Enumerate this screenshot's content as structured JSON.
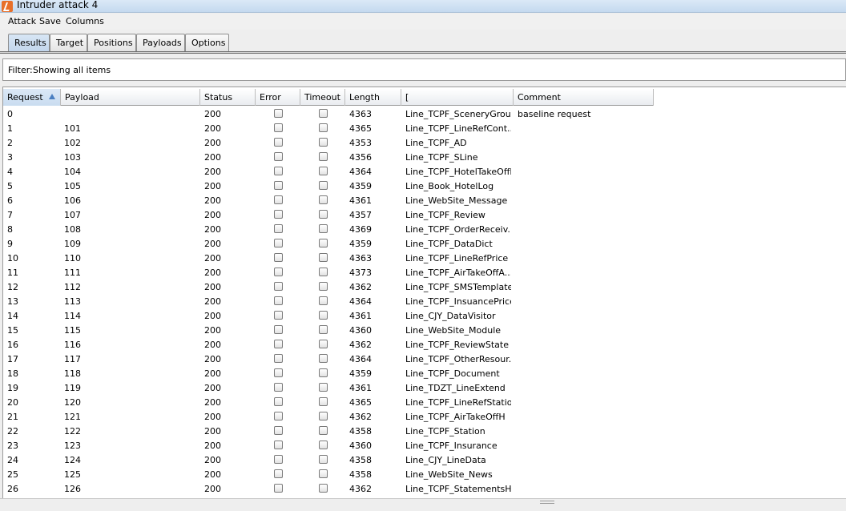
{
  "window": {
    "title": "Intruder attack 4"
  },
  "menu": [
    "Attack",
    "Save",
    "Columns"
  ],
  "tabs": [
    "Results",
    "Target",
    "Positions",
    "Payloads",
    "Options"
  ],
  "active_tab": "Results",
  "filter": {
    "label": "Filter:",
    "value": "Showing all items"
  },
  "columns": [
    "Request",
    "Payload",
    "Status",
    "Error",
    "Timeout",
    "Length",
    "[",
    "Comment"
  ],
  "rows": [
    {
      "request": "0",
      "payload": "",
      "status": "200",
      "error": false,
      "timeout": false,
      "length": "4363",
      "match": "Line_TCPF_SceneryGroup",
      "comment": "baseline request"
    },
    {
      "request": "1",
      "payload": "101",
      "status": "200",
      "error": false,
      "timeout": false,
      "length": "4365",
      "match": "Line_TCPF_LineRefCont...",
      "comment": ""
    },
    {
      "request": "2",
      "payload": "102",
      "status": "200",
      "error": false,
      "timeout": false,
      "length": "4353",
      "match": "Line_TCPF_AD",
      "comment": ""
    },
    {
      "request": "3",
      "payload": "103",
      "status": "200",
      "error": false,
      "timeout": false,
      "length": "4356",
      "match": "Line_TCPF_SLine",
      "comment": ""
    },
    {
      "request": "4",
      "payload": "104",
      "status": "200",
      "error": false,
      "timeout": false,
      "length": "4364",
      "match": "Line_TCPF_HotelTakeOffL",
      "comment": ""
    },
    {
      "request": "5",
      "payload": "105",
      "status": "200",
      "error": false,
      "timeout": false,
      "length": "4359",
      "match": "Line_Book_HotelLog",
      "comment": ""
    },
    {
      "request": "6",
      "payload": "106",
      "status": "200",
      "error": false,
      "timeout": false,
      "length": "4361",
      "match": "Line_WebSite_Message",
      "comment": ""
    },
    {
      "request": "7",
      "payload": "107",
      "status": "200",
      "error": false,
      "timeout": false,
      "length": "4357",
      "match": "Line_TCPF_Review",
      "comment": ""
    },
    {
      "request": "8",
      "payload": "108",
      "status": "200",
      "error": false,
      "timeout": false,
      "length": "4369",
      "match": "Line_TCPF_OrderReceiv...",
      "comment": ""
    },
    {
      "request": "9",
      "payload": "109",
      "status": "200",
      "error": false,
      "timeout": false,
      "length": "4359",
      "match": "Line_TCPF_DataDict",
      "comment": ""
    },
    {
      "request": "10",
      "payload": "110",
      "status": "200",
      "error": false,
      "timeout": false,
      "length": "4363",
      "match": "Line_TCPF_LineRefPrice",
      "comment": ""
    },
    {
      "request": "11",
      "payload": "111",
      "status": "200",
      "error": false,
      "timeout": false,
      "length": "4373",
      "match": "Line_TCPF_AirTakeOffA...",
      "comment": ""
    },
    {
      "request": "12",
      "payload": "112",
      "status": "200",
      "error": false,
      "timeout": false,
      "length": "4362",
      "match": "Line_TCPF_SMSTemplate",
      "comment": ""
    },
    {
      "request": "13",
      "payload": "113",
      "status": "200",
      "error": false,
      "timeout": false,
      "length": "4364",
      "match": "Line_TCPF_InsuancePrice",
      "comment": ""
    },
    {
      "request": "14",
      "payload": "114",
      "status": "200",
      "error": false,
      "timeout": false,
      "length": "4361",
      "match": "Line_CJY_DataVisitor",
      "comment": ""
    },
    {
      "request": "15",
      "payload": "115",
      "status": "200",
      "error": false,
      "timeout": false,
      "length": "4360",
      "match": "Line_WebSite_Module",
      "comment": ""
    },
    {
      "request": "16",
      "payload": "116",
      "status": "200",
      "error": false,
      "timeout": false,
      "length": "4362",
      "match": "Line_TCPF_ReviewState",
      "comment": ""
    },
    {
      "request": "17",
      "payload": "117",
      "status": "200",
      "error": false,
      "timeout": false,
      "length": "4364",
      "match": "Line_TCPF_OtherResour...",
      "comment": ""
    },
    {
      "request": "18",
      "payload": "118",
      "status": "200",
      "error": false,
      "timeout": false,
      "length": "4359",
      "match": "Line_TCPF_Document",
      "comment": ""
    },
    {
      "request": "19",
      "payload": "119",
      "status": "200",
      "error": false,
      "timeout": false,
      "length": "4361",
      "match": "Line_TDZT_LineExtend",
      "comment": ""
    },
    {
      "request": "20",
      "payload": "120",
      "status": "200",
      "error": false,
      "timeout": false,
      "length": "4365",
      "match": "Line_TCPF_LineRefStation",
      "comment": ""
    },
    {
      "request": "21",
      "payload": "121",
      "status": "200",
      "error": false,
      "timeout": false,
      "length": "4362",
      "match": "Line_TCPF_AirTakeOffH",
      "comment": ""
    },
    {
      "request": "22",
      "payload": "122",
      "status": "200",
      "error": false,
      "timeout": false,
      "length": "4358",
      "match": "Line_TCPF_Station",
      "comment": ""
    },
    {
      "request": "23",
      "payload": "123",
      "status": "200",
      "error": false,
      "timeout": false,
      "length": "4360",
      "match": "Line_TCPF_Insurance",
      "comment": ""
    },
    {
      "request": "24",
      "payload": "124",
      "status": "200",
      "error": false,
      "timeout": false,
      "length": "4358",
      "match": "Line_CJY_LineData",
      "comment": ""
    },
    {
      "request": "25",
      "payload": "125",
      "status": "200",
      "error": false,
      "timeout": false,
      "length": "4358",
      "match": "Line_WebSite_News",
      "comment": ""
    },
    {
      "request": "26",
      "payload": "126",
      "status": "200",
      "error": false,
      "timeout": false,
      "length": "4362",
      "match": "Line_TCPF_StatementsH",
      "comment": ""
    }
  ]
}
